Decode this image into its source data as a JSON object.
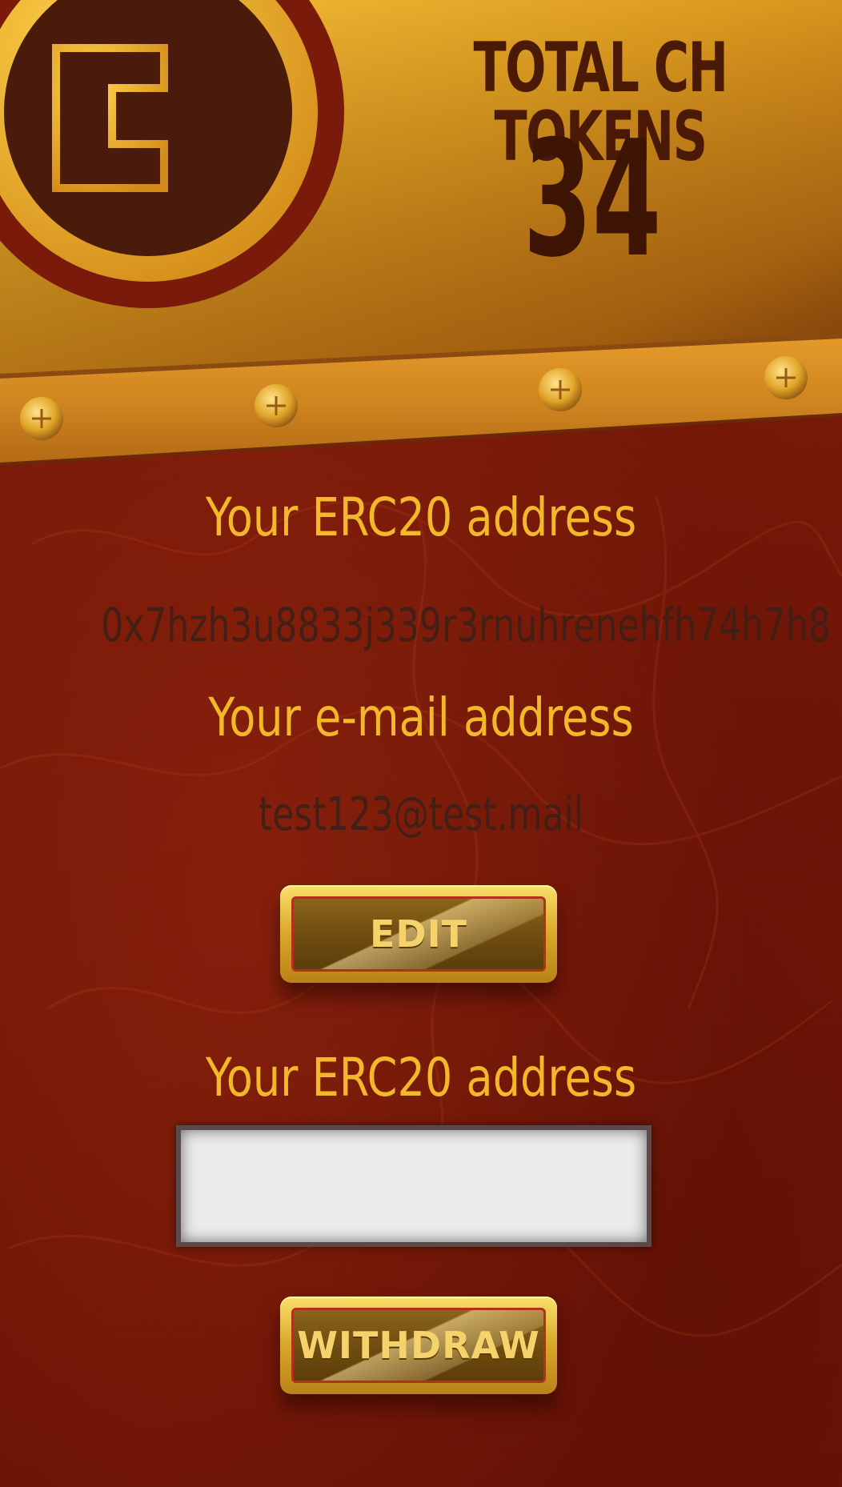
{
  "header": {
    "total_label": "TOTAL CH TOKENS",
    "total_value": "34",
    "logo_letter": "C"
  },
  "account": {
    "erc20_label": "Your ERC20 address",
    "erc20_value": "0x7hzh3u8833j339r3rnuhrenehfh74h7h8",
    "email_label": "Your e-mail address",
    "email_value": "test123@test.mail",
    "edit_button": "EDIT"
  },
  "withdraw": {
    "erc20_label": "Your ERC20 address",
    "erc20_input_value": "",
    "withdraw_button": "WITHDRAW"
  },
  "colors": {
    "background": "#7a1a08",
    "label_gold": "#f2b82a",
    "header_gold": "#e4a521",
    "dark_brown_text": "#4a1a07"
  }
}
